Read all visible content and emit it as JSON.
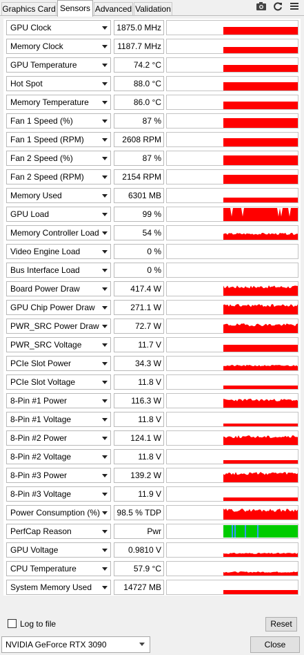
{
  "tabs": [
    "Graphics Card",
    "Sensors",
    "Advanced",
    "Validation"
  ],
  "active_tab": 1,
  "toolbar_icons": [
    "camera-icon",
    "refresh-icon",
    "menu-icon"
  ],
  "graph_color": "#ff0000",
  "perfcap_color": "#00cc00",
  "perfcap_marker_color": "#3399ff",
  "sensors": [
    {
      "label": "GPU Clock",
      "value": "1875.0 MHz",
      "level": 0.55,
      "graph": "flat"
    },
    {
      "label": "Memory Clock",
      "value": "1187.7 MHz",
      "level": 0.45,
      "graph": "flat"
    },
    {
      "label": "GPU Temperature",
      "value": "74.2 °C",
      "level": 0.5,
      "graph": "flat"
    },
    {
      "label": "Hot Spot",
      "value": "88.0 °C",
      "level": 0.6,
      "graph": "flat"
    },
    {
      "label": "Memory Temperature",
      "value": "86.0 °C",
      "level": 0.55,
      "graph": "flat"
    },
    {
      "label": "Fan 1 Speed (%)",
      "value": "87 %",
      "level": 0.7,
      "graph": "flat"
    },
    {
      "label": "Fan 1 Speed (RPM)",
      "value": "2608 RPM",
      "level": 0.6,
      "graph": "flat"
    },
    {
      "label": "Fan 2 Speed (%)",
      "value": "87 %",
      "level": 0.7,
      "graph": "flat"
    },
    {
      "label": "Fan 2 Speed (RPM)",
      "value": "2154 RPM",
      "level": 0.65,
      "graph": "flat"
    },
    {
      "label": "Memory Used",
      "value": "6301 MB",
      "level": 0.35,
      "graph": "flat"
    },
    {
      "label": "GPU Load",
      "value": "99 %",
      "level": 0.95,
      "graph": "spiky"
    },
    {
      "label": "Memory Controller Load",
      "value": "54 %",
      "level": 0.5,
      "graph": "noisy"
    },
    {
      "label": "Video Engine Load",
      "value": "0 %",
      "level": 0,
      "graph": "none"
    },
    {
      "label": "Bus Interface Load",
      "value": "0 %",
      "level": 0,
      "graph": "none"
    },
    {
      "label": "Board Power Draw",
      "value": "417.4 W",
      "level": 0.75,
      "graph": "noisy"
    },
    {
      "label": "GPU Chip Power Draw",
      "value": "271.1 W",
      "level": 0.75,
      "graph": "noisy"
    },
    {
      "label": "PWR_SRC Power Draw",
      "value": "72.7 W",
      "level": 0.7,
      "graph": "noisy"
    },
    {
      "label": "PWR_SRC Voltage",
      "value": "11.7 V",
      "level": 0.5,
      "graph": "flat"
    },
    {
      "label": "PCIe Slot Power",
      "value": "34.3 W",
      "level": 0.4,
      "graph": "noisy"
    },
    {
      "label": "PCIe Slot Voltage",
      "value": "11.8 V",
      "level": 0.25,
      "graph": "flat"
    },
    {
      "label": "8-Pin #1 Power",
      "value": "116.3 W",
      "level": 0.65,
      "graph": "noisy"
    },
    {
      "label": "8-Pin #1 Voltage",
      "value": "11.8 V",
      "level": 0.2,
      "graph": "flat"
    },
    {
      "label": "8-Pin #2 Power",
      "value": "124.1 W",
      "level": 0.7,
      "graph": "noisy"
    },
    {
      "label": "8-Pin #2 Voltage",
      "value": "11.8 V",
      "level": 0.25,
      "graph": "flat"
    },
    {
      "label": "8-Pin #3 Power",
      "value": "139.2 W",
      "level": 0.75,
      "graph": "noisy"
    },
    {
      "label": "8-Pin #3 Voltage",
      "value": "11.9 V",
      "level": 0.25,
      "graph": "flat"
    },
    {
      "label": "Power Consumption (%)",
      "value": "98.5 % TDP",
      "level": 0.8,
      "graph": "noisy"
    },
    {
      "label": "PerfCap Reason",
      "value": "Pwr",
      "level": 1,
      "graph": "perfcap"
    },
    {
      "label": "GPU Voltage",
      "value": "0.9810 V",
      "level": 0.3,
      "graph": "noisy"
    },
    {
      "label": "CPU Temperature",
      "value": "57.9 °C",
      "level": 0.3,
      "graph": "noisy"
    },
    {
      "label": "System Memory Used",
      "value": "14727 MB",
      "level": 0.3,
      "graph": "flat"
    }
  ],
  "log_to_file": {
    "label": "Log to file",
    "checked": false
  },
  "reset_label": "Reset",
  "gpu_select": "NVIDIA GeForce RTX 3090",
  "close_label": "Close"
}
